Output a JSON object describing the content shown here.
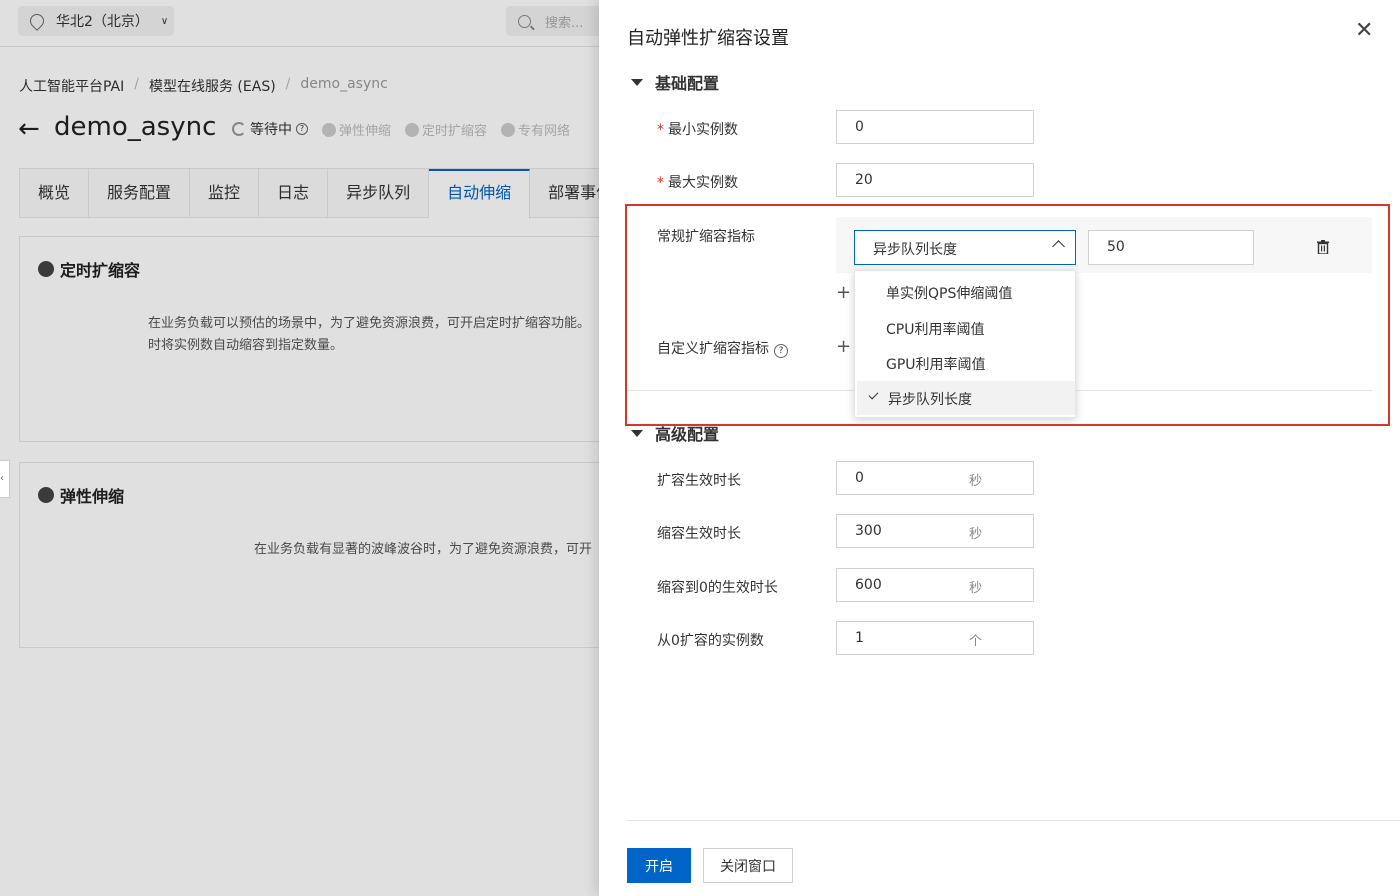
{
  "topbar": {
    "region": "华北2（北京）",
    "search_placeholder": "搜索..."
  },
  "breadcrumb": [
    "人工智能平台PAI",
    "模型在线服务 (EAS)",
    "demo_async"
  ],
  "service": {
    "name": "demo_async",
    "status": "等待中",
    "links": [
      "弹性伸缩",
      "定时扩缩容",
      "专有网络"
    ]
  },
  "tabs": [
    "概览",
    "服务配置",
    "监控",
    "日志",
    "异步队列",
    "自动伸缩",
    "部署事件"
  ],
  "cards": {
    "scheduled": {
      "title": "定时扩缩容",
      "desc1": "在业务负载可以预估的场景中，为了避免资源浪费，可开启定时扩缩容功能。",
      "desc2": "时将实例数自动缩容到指定数量。"
    },
    "elastic": {
      "title": "弹性伸缩",
      "desc": "在业务负载有显著的波峰波谷时，为了避免资源浪费，可开"
    }
  },
  "drawer": {
    "title": "自动弹性扩缩容设置",
    "basic": {
      "header": "基础配置",
      "min_label": "最小实例数",
      "min_value": "0",
      "max_label": "最大实例数",
      "max_value": "20",
      "metric_label": "常规扩缩容指标",
      "metric_selected": "异步队列长度",
      "metric_threshold": "50",
      "custom_label": "自定义扩缩容指标",
      "options": [
        "单实例QPS伸缩阈值",
        "CPU利用率阈值",
        "GPU利用率阈值",
        "异步队列长度"
      ]
    },
    "advanced": {
      "header": "高级配置",
      "rows": [
        {
          "label": "扩容生效时长",
          "value": "0",
          "unit": "秒"
        },
        {
          "label": "缩容生效时长",
          "value": "300",
          "unit": "秒"
        },
        {
          "label": "缩容到0的生效时长",
          "value": "600",
          "unit": "秒"
        },
        {
          "label": "从0扩容的实例数",
          "value": "1",
          "unit": "个"
        }
      ]
    },
    "buttons": {
      "enable": "开启",
      "close": "关闭窗口"
    }
  },
  "colors": {
    "primary": "#0064c8",
    "highlight": "#d9362b",
    "required": "#d93026"
  }
}
